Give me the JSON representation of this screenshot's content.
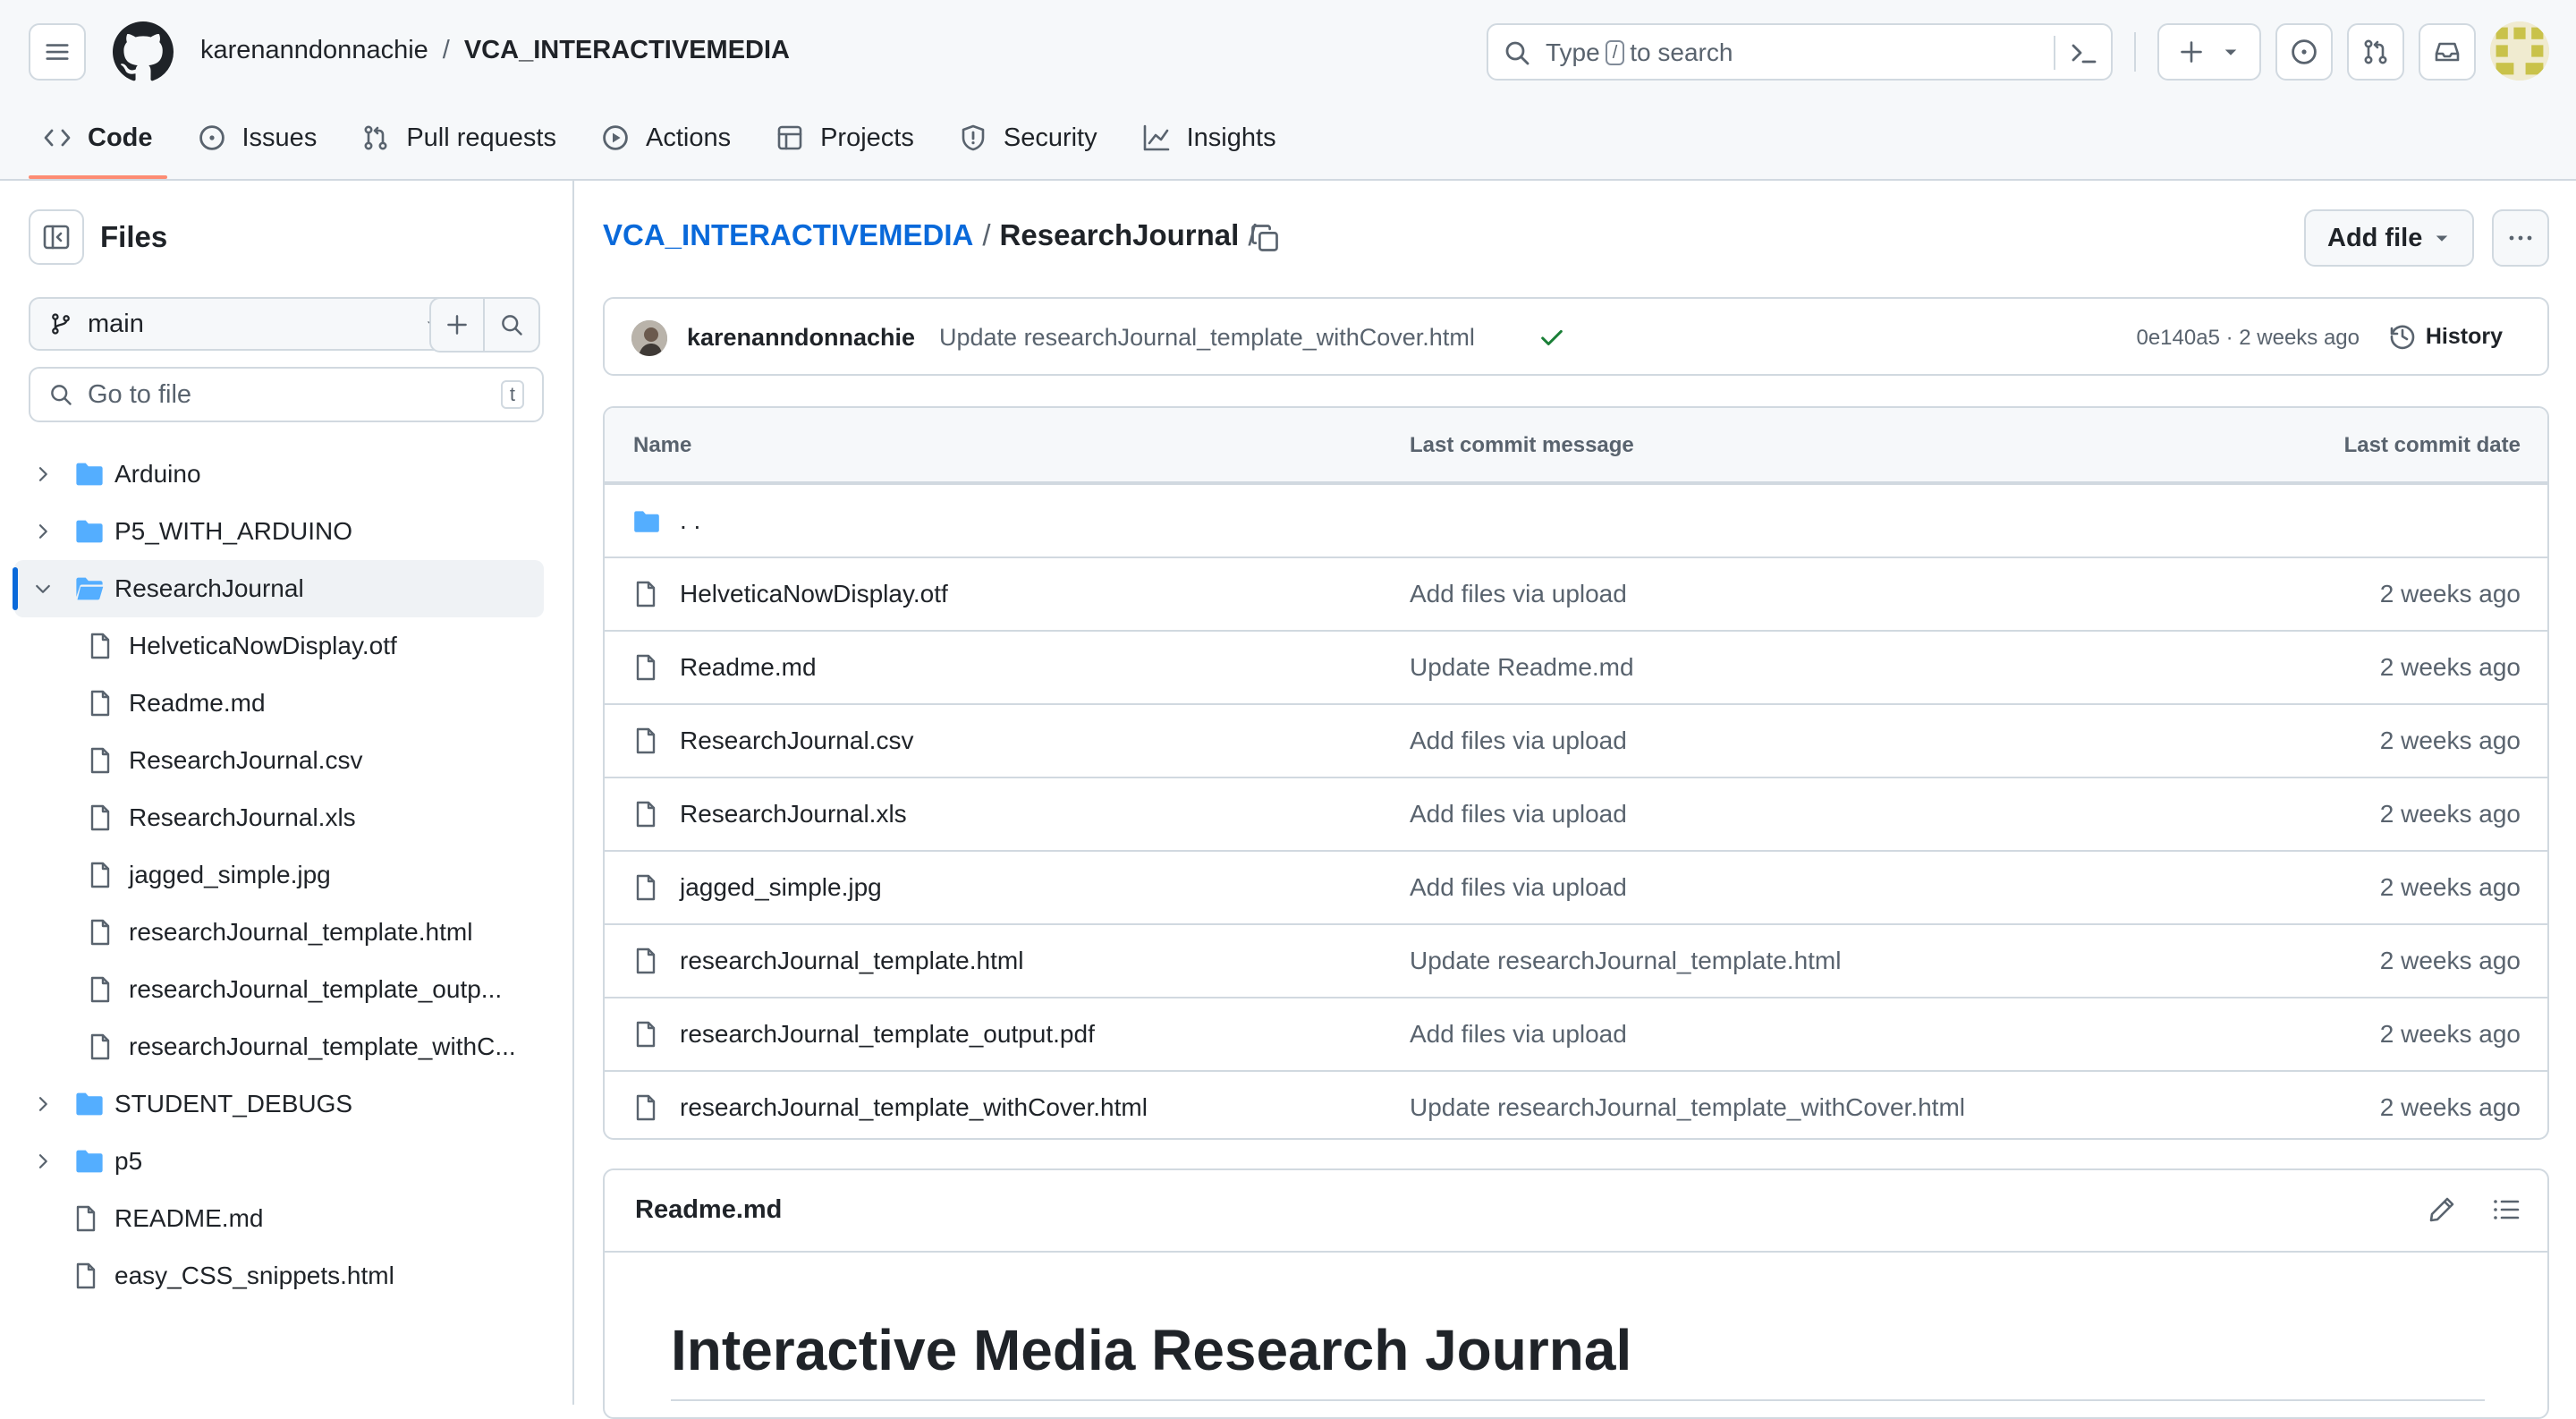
{
  "header": {
    "owner": "karenanndonnachie",
    "separator": "/",
    "repo": "VCA_INTERACTIVEMEDIA",
    "search_prefix": "Type",
    "search_key": "/",
    "search_suffix": "to search"
  },
  "repo_nav": [
    {
      "label": "Code",
      "icon": "code-icon"
    },
    {
      "label": "Issues",
      "icon": "issue-icon"
    },
    {
      "label": "Pull requests",
      "icon": "pull-request-icon"
    },
    {
      "label": "Actions",
      "icon": "play-icon"
    },
    {
      "label": "Projects",
      "icon": "table-icon"
    },
    {
      "label": "Security",
      "icon": "shield-icon"
    },
    {
      "label": "Insights",
      "icon": "graph-icon"
    }
  ],
  "sidebar": {
    "title": "Files",
    "branch": "main",
    "go_to_file": "Go to file",
    "go_to_file_key": "t",
    "tree": [
      {
        "label": "Arduino",
        "type": "folder"
      },
      {
        "label": "P5_WITH_ARDUINO",
        "type": "folder"
      },
      {
        "label": "ResearchJournal",
        "type": "folder-open"
      },
      {
        "label": "HelveticaNowDisplay.otf",
        "type": "file"
      },
      {
        "label": "Readme.md",
        "type": "file"
      },
      {
        "label": "ResearchJournal.csv",
        "type": "file"
      },
      {
        "label": "ResearchJournal.xls",
        "type": "file"
      },
      {
        "label": "jagged_simple.jpg",
        "type": "file"
      },
      {
        "label": "researchJournal_template.html",
        "type": "file"
      },
      {
        "label": "researchJournal_template_outp...",
        "type": "file"
      },
      {
        "label": "researchJournal_template_withC...",
        "type": "file"
      },
      {
        "label": "STUDENT_DEBUGS",
        "type": "folder"
      },
      {
        "label": "p5",
        "type": "folder"
      },
      {
        "label": "README.md",
        "type": "file"
      },
      {
        "label": "easy_CSS_snippets.html",
        "type": "file"
      }
    ]
  },
  "main": {
    "path_root": "VCA_INTERACTIVEMEDIA",
    "path_sep": "/",
    "path_current": "ResearchJournal",
    "path_trailing": "/",
    "add_file": "Add file",
    "commit": {
      "author": "karenanndonnachie",
      "message": "Update researchJournal_template_withCover.html",
      "meta": "0e140a5 · 2 weeks ago",
      "history": "History"
    },
    "table_headers": {
      "name": "Name",
      "message": "Last commit message",
      "date": "Last commit date"
    },
    "parent_dir": ". .",
    "files": [
      {
        "name": "HelveticaNowDisplay.otf",
        "message": "Add files via upload",
        "date": "2 weeks ago"
      },
      {
        "name": "Readme.md",
        "message": "Update Readme.md",
        "date": "2 weeks ago"
      },
      {
        "name": "ResearchJournal.csv",
        "message": "Add files via upload",
        "date": "2 weeks ago"
      },
      {
        "name": "ResearchJournal.xls",
        "message": "Add files via upload",
        "date": "2 weeks ago"
      },
      {
        "name": "jagged_simple.jpg",
        "message": "Add files via upload",
        "date": "2 weeks ago"
      },
      {
        "name": "researchJournal_template.html",
        "message": "Update researchJournal_template.html",
        "date": "2 weeks ago"
      },
      {
        "name": "researchJournal_template_output.pdf",
        "message": "Add files via upload",
        "date": "2 weeks ago"
      },
      {
        "name": "researchJournal_template_withCover.html",
        "message": "Update researchJournal_template_withCover.html",
        "date": "2 weeks ago"
      }
    ],
    "readme": {
      "filename": "Readme.md",
      "heading": "Interactive Media Research Journal"
    }
  },
  "colors": {
    "accent": "#0969da",
    "folder": "#54aeff",
    "success": "#1a7f37",
    "active_tab_underline": "#fd8c73"
  }
}
